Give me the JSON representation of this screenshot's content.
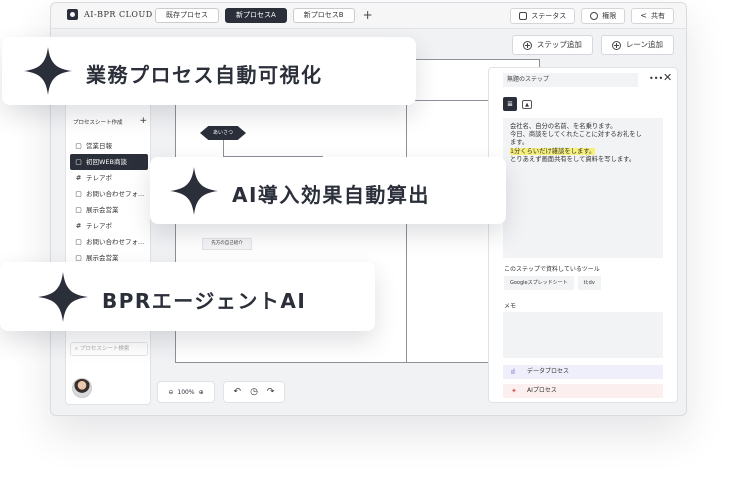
{
  "app": {
    "logo_text": "AI-BPR CLOUD"
  },
  "tabs": [
    {
      "label": "既存プロセス",
      "active": false
    },
    {
      "label": "新プロセスA",
      "active": true
    },
    {
      "label": "新プロセスB",
      "active": false
    }
  ],
  "tab_add": "+",
  "top_actions": {
    "status": "ステータス",
    "permission": "権限",
    "share": "共有"
  },
  "actions": {
    "add_step": "ステップ追加",
    "add_lane": "レーン追加"
  },
  "sidebar": {
    "header": "プロセスシート作成",
    "header_add": "+",
    "items": [
      {
        "glyph": "▢",
        "label": "営業日報",
        "active": false
      },
      {
        "glyph": "▢",
        "label": "初回WEB商談",
        "active": true
      },
      {
        "glyph": "#",
        "label": "テレアポ",
        "active": false
      },
      {
        "glyph": "▢",
        "label": "お問い合わせフォ...",
        "active": false
      },
      {
        "glyph": "▢",
        "label": "展示会営業",
        "active": false
      },
      {
        "glyph": "#",
        "label": "テレアポ",
        "active": false
      },
      {
        "glyph": "▢",
        "label": "お問い合わせフォ...",
        "active": false
      },
      {
        "glyph": "▢",
        "label": "展示会営業",
        "active": false
      }
    ],
    "search_placeholder": "プロセスシート検索"
  },
  "canvas": {
    "decision_label": "あいさつ",
    "node_label": "先方の自己紹介",
    "zoom": "100%"
  },
  "panel": {
    "step_title": "無題のステップ",
    "more": "•••",
    "close": "✕",
    "script_lines": [
      "会社名、自分の名前、を名乗ります。",
      "今日、商談をしてくれたことに対するお礼をし",
      "ます。",
      "1分くらいだけ雑談をします。",
      "とりあえず画面共有をして資料を写します。"
    ],
    "tools_label": "このステップで資料しているツール",
    "tools": [
      "Googleスプレッドシート",
      "tl;dv"
    ],
    "memo_label": "メモ",
    "data_process": "データプロセス",
    "ai_process": "AIプロセス"
  },
  "callouts": [
    "業務プロセス自動可視化",
    "AI導入効果自動算出",
    "BPRエージェントAI"
  ],
  "colors": {
    "accent_dark": "#2b2f3a",
    "highlight": "#f6f07a",
    "data_row": "#efeffb",
    "ai_row": "#fcefef"
  }
}
